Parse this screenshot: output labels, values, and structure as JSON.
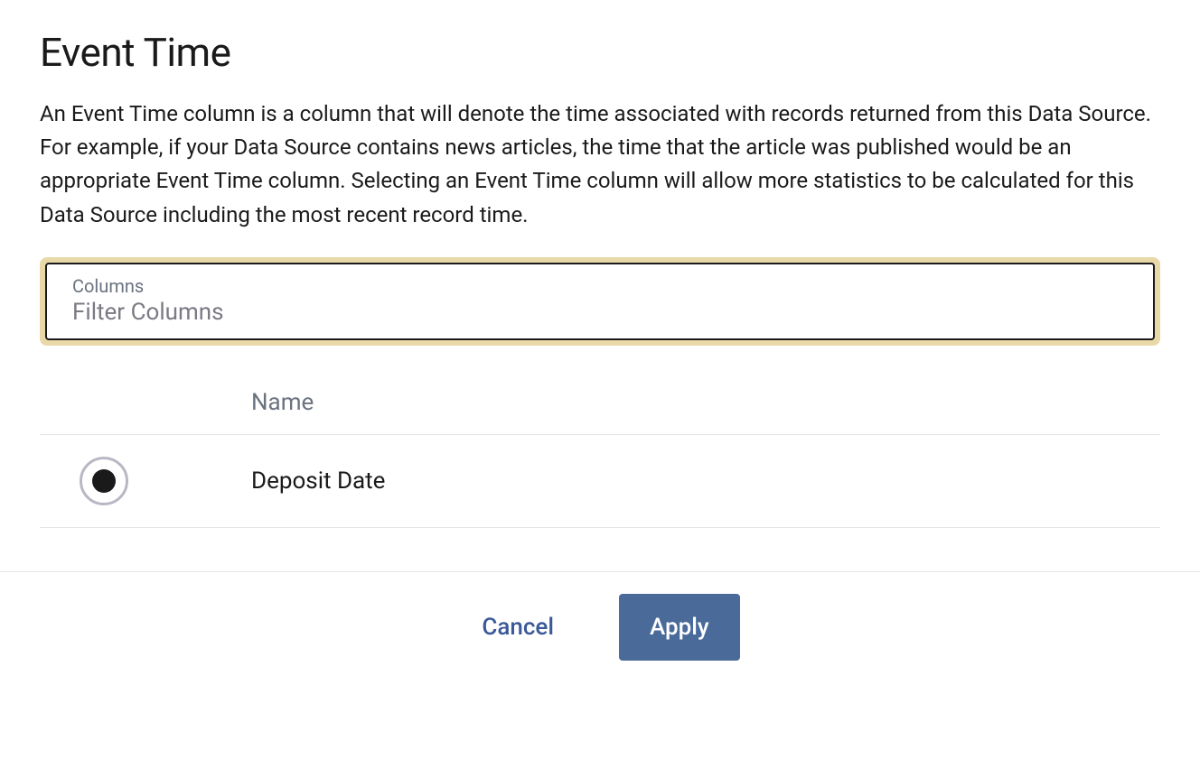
{
  "header": {
    "title": "Event Time",
    "description": "An Event Time column is a column that will denote the time associated with records returned from this Data Source. For example, if your Data Source contains news articles, the time that the article was published would be an appropriate Event Time column. Selecting an Event Time column will allow more statistics to be calculated for this Data Source including the most recent record time."
  },
  "filter": {
    "label": "Columns",
    "placeholder": "Filter Columns",
    "value": ""
  },
  "table": {
    "header": {
      "name": "Name"
    },
    "rows": [
      {
        "name": "Deposit Date",
        "selected": true
      }
    ]
  },
  "footer": {
    "cancel": "Cancel",
    "apply": "Apply"
  }
}
